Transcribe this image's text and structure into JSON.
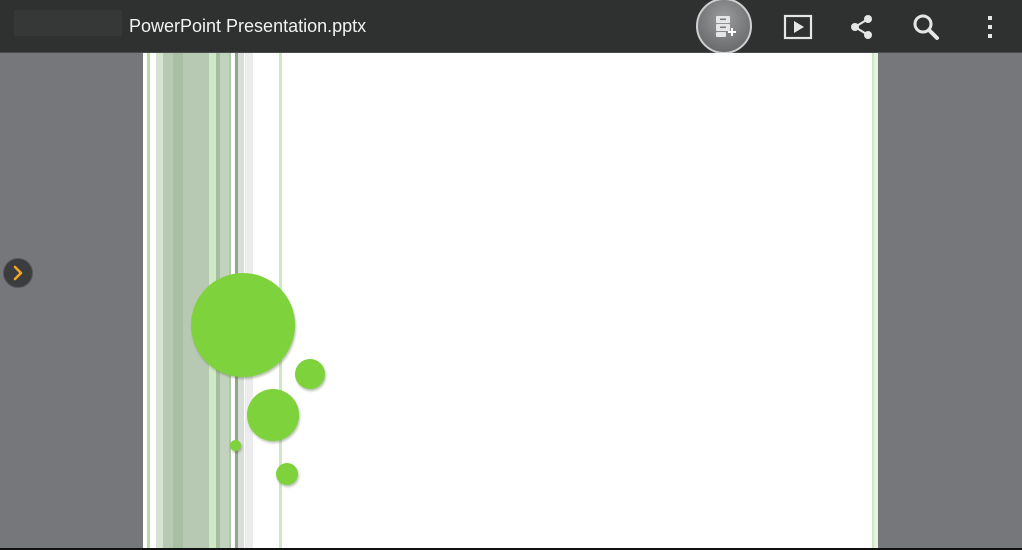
{
  "app": {
    "document_title": "PowerPoint Presentation.pptx"
  },
  "toolbar": {
    "save_icon": "save-to-storage-icon",
    "play_icon": "slideshow-play-icon",
    "share_icon": "share-icon",
    "search_icon": "search-icon",
    "more_icon": "overflow-menu-icon"
  },
  "drawer": {
    "icon": "chevron-right-icon"
  },
  "colors": {
    "toolbar_bg": "#2f3030",
    "workspace_bg": "#76777b",
    "slide_bg": "#ffffff",
    "accent_green": "#7ed23b",
    "handle_arrow": "#f5a623"
  }
}
